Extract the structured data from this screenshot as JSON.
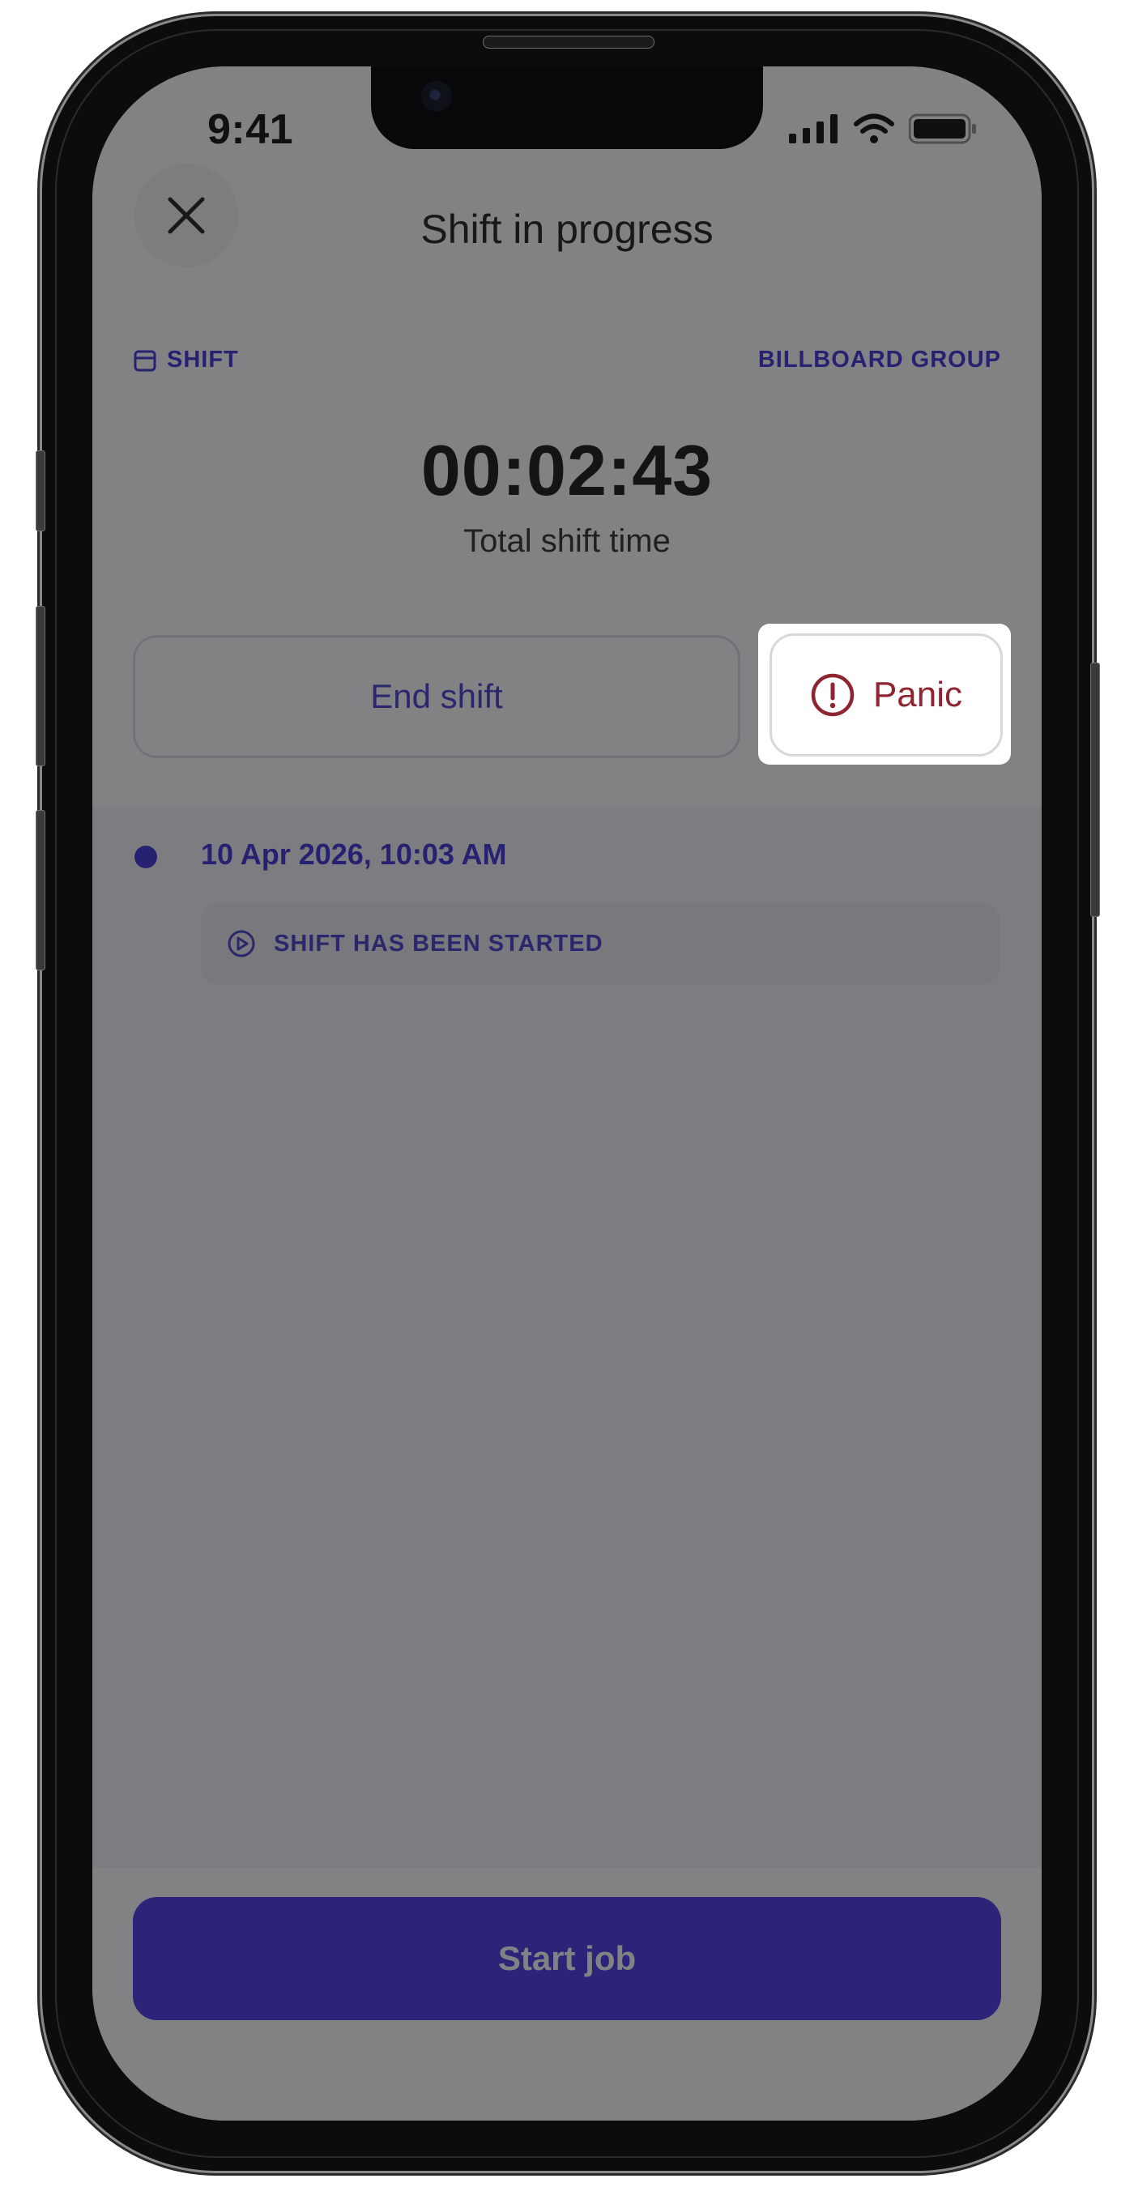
{
  "status_bar": {
    "time": "9:41"
  },
  "header": {
    "title": "Shift in progress"
  },
  "shift": {
    "section_label": "SHIFT",
    "company": "BILLBOARD GROUP",
    "timer": "00:02:43",
    "timer_caption": "Total shift time"
  },
  "actions": {
    "end_shift_label": "End shift",
    "panic_label": "Panic"
  },
  "timeline": [
    {
      "date": "10 Apr 2026, 10:03 AM",
      "event": "SHIFT HAS BEEN STARTED"
    }
  ],
  "footer": {
    "start_job_label": "Start job"
  },
  "colors": {
    "accent": "#4a3ce8",
    "panic": "#8e2530",
    "overlay": "rgba(16,16,20,0.52)"
  },
  "icons": [
    "close-icon",
    "calendar-icon",
    "alert-circle-icon",
    "play-circle-icon",
    "signal-icon",
    "wifi-icon",
    "battery-icon"
  ]
}
